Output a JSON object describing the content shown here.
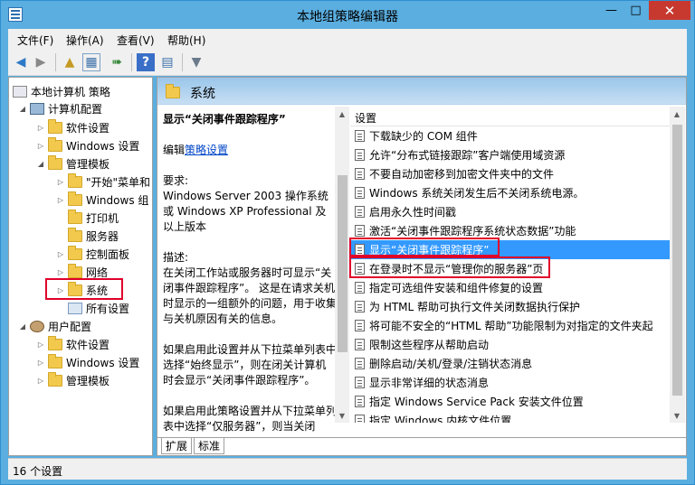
{
  "window": {
    "title": "本地组策略编辑器"
  },
  "menu": [
    "文件(F)",
    "操作(A)",
    "查看(V)",
    "帮助(H)"
  ],
  "toolbar": {
    "icons": [
      "back-arrow-icon",
      "forward-arrow-icon",
      "up-folder-icon",
      "show-hide-tree-icon",
      "export-list-icon",
      "help-icon",
      "properties-view-icon",
      "filter-icon"
    ]
  },
  "tree": {
    "root": "本地计算机 策略",
    "items": [
      {
        "label": "计算机配置"
      },
      {
        "label": "软件设置"
      },
      {
        "label": "Windows 设置"
      },
      {
        "label": "管理模板"
      },
      {
        "label": "\"开始\"菜单和"
      },
      {
        "label": "Windows 组"
      },
      {
        "label": "打印机"
      },
      {
        "label": "服务器"
      },
      {
        "label": "控制面板"
      },
      {
        "label": "网络"
      },
      {
        "label": "系统"
      },
      {
        "label": "所有设置"
      },
      {
        "label": "用户配置"
      },
      {
        "label": "软件设置"
      },
      {
        "label": "Windows 设置"
      },
      {
        "label": "管理模板"
      }
    ]
  },
  "right": {
    "header": "系统",
    "desc": {
      "title": "显示“关闭事件跟踪程序”",
      "edit_prefix": "编辑",
      "edit_link": "策略设置",
      "req_label": "要求:",
      "req_text": "Windows Server 2003 操作系统或 Windows XP Professional 及以上版本",
      "desc_label": "描述:",
      "desc_text": "在关闭工作站或服务器时可显示“关闭事件跟踪程序”。 这是在请求关机时显示的一组额外的问题，用于收集与关机原因有关的信息。",
      "para2": "如果启用此设置并从下拉菜单列表中选择“始终显示”，则在闭关计算机时会显示“关闭事件跟踪程序”。",
      "para3": "如果启用此策略设置并从下拉菜单列表中选择“仅服务器”，则当关闭"
    },
    "column": "设置",
    "rows": [
      "下载缺少的 COM 组件",
      "允许“分布式链接跟踪”客户端使用域资源",
      "不要自动加密移到加密文件夹中的文件",
      "Windows 系统关闭发生后不关闭系统电源。",
      "启用永久性时间戳",
      "激活“关闭事件跟踪程序系统状态数据”功能",
      "显示“关闭事件跟踪程序”",
      "在登录时不显示“管理你的服务器”页",
      "指定可选组件安装和组件修复的设置",
      "为 HTML 帮助可执行文件关闭数据执行保护",
      "将可能不安全的“HTML 帮助”功能限制为对指定的文件夹起",
      "限制这些程序从帮助启动",
      "删除启动/关机/登录/注销状态消息",
      "显示非常详细的状态消息",
      "指定 Windows Service Pack 安装文件位置",
      "指定 Windows 内核文件位置"
    ],
    "tabs": [
      "扩展",
      "标准"
    ]
  },
  "status": "16 个设置",
  "colors": {
    "title_bar": "#5aaee0",
    "selection": "#3399ff",
    "highlight_box": "#e0002a"
  }
}
